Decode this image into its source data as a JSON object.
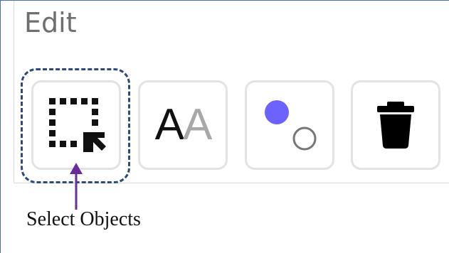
{
  "panel": {
    "title": "Edit"
  },
  "toolbar": {
    "buttons": [
      {
        "name": "select-objects",
        "icon": "select-region-cursor-icon"
      },
      {
        "name": "text-style",
        "icon": "text-aa-icon",
        "glyph_dark": "A",
        "glyph_light": "A"
      },
      {
        "name": "shape-color",
        "icon": "shapes-dot-circle-icon",
        "accent": "#6c63ff"
      },
      {
        "name": "delete",
        "icon": "trash-icon"
      }
    ]
  },
  "annotation": {
    "label": "Select Objects",
    "arrow_color": "#6a2c9a",
    "highlight_color": "#2e4a7a"
  }
}
